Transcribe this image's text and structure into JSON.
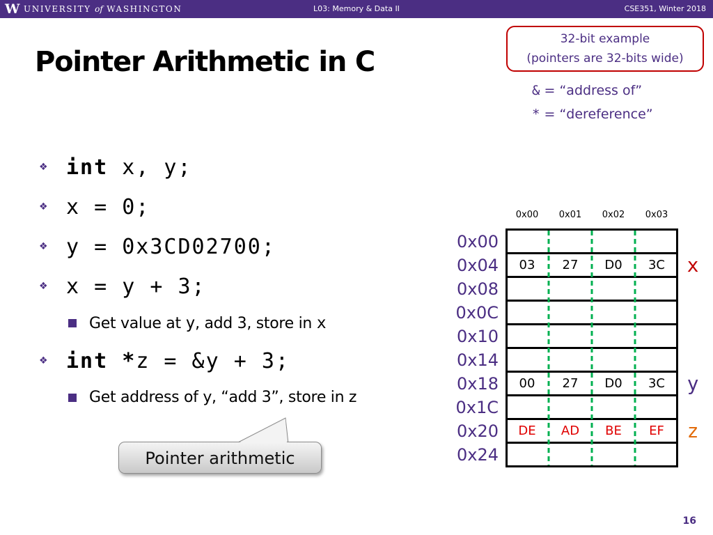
{
  "header": {
    "logo": "W",
    "university_name": [
      "UNIVERSITY",
      "of",
      "WASHINGTON"
    ],
    "lecture": "L03:  Memory & Data II",
    "course": "CSE351, Winter 2018",
    "bar_color": "#4b2e83"
  },
  "title": "Pointer Arithmetic in C",
  "callout": {
    "line1": "32-bit example",
    "line2": "(pointers are 32-bits wide)",
    "border_color": "#c00000"
  },
  "legend": [
    {
      "op": "&",
      "text": " = “address of”"
    },
    {
      "op": "*",
      "text": " = “dereference”"
    }
  ],
  "bullets": [
    {
      "kw": "int",
      "code": " x, y;"
    },
    {
      "code": "x = 0;"
    },
    {
      "code": "y = 0x3CD02700;"
    },
    {
      "code": "x = y + 3;"
    },
    {
      "kw": "int *",
      "code": "z = &y + 3;"
    }
  ],
  "subbullets": [
    {
      "parts": [
        "Get value at ",
        "y",
        ", add 3, store in ",
        "x"
      ]
    },
    {
      "parts": [
        "Get address of y, “add 3”, store in z"
      ]
    }
  ],
  "bubble": "Pointer arithmetic",
  "memory": {
    "col_headers": [
      "0x00",
      "0x01",
      "0x02",
      "0x03"
    ],
    "rows": [
      {
        "addr": "0x00",
        "cells": [
          "",
          "",
          "",
          ""
        ],
        "label": ""
      },
      {
        "addr": "0x04",
        "cells": [
          "03",
          "27",
          "D0",
          "3C"
        ],
        "label": "x"
      },
      {
        "addr": "0x08",
        "cells": [
          "",
          "",
          "",
          ""
        ],
        "label": ""
      },
      {
        "addr": "0x0C",
        "cells": [
          "",
          "",
          "",
          ""
        ],
        "label": ""
      },
      {
        "addr": "0x10",
        "cells": [
          "",
          "",
          "",
          ""
        ],
        "label": ""
      },
      {
        "addr": "0x14",
        "cells": [
          "",
          "",
          "",
          ""
        ],
        "label": ""
      },
      {
        "addr": "0x18",
        "cells": [
          "00",
          "27",
          "D0",
          "3C"
        ],
        "label": "y"
      },
      {
        "addr": "0x1C",
        "cells": [
          "",
          "",
          "",
          ""
        ],
        "label": ""
      },
      {
        "addr": "0x20",
        "cells": [
          "DE",
          "AD",
          "BE",
          "EF"
        ],
        "label": "z",
        "highlight": true
      },
      {
        "addr": "0x24",
        "cells": [
          "",
          "",
          "",
          ""
        ],
        "label": ""
      }
    ],
    "label_colors": {
      "x": "#c00000",
      "y": "#4b2e83",
      "z": "#e26b0a"
    },
    "highlight_color": "#e00000",
    "divider_color": "#00b050"
  },
  "page_number": "16"
}
